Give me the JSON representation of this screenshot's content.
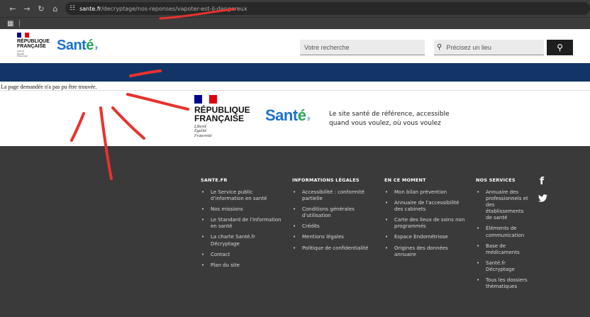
{
  "browser": {
    "url_host": "sante.fr",
    "url_path": "/decryptage/nos-reponses/vapoter-est-il-dangereux"
  },
  "header": {
    "rf_line1": "RÉPUBLIQUE",
    "rf_line2": "FRANÇAISE",
    "motto": [
      "Liberté",
      "Égalité",
      "Fraternité"
    ],
    "logo_main": "Sant",
    "logo_accent": "é",
    "logo_suffix": ".fr",
    "search_placeholder": "Votre recherche",
    "place_placeholder": "Précisez un lieu"
  },
  "error_message": "La page demandée n'a pas pu être trouvée.",
  "brand": {
    "tagline_line1": "Le site santé de référence, accessible",
    "tagline_line2": "quand vous voulez, où vous voulez"
  },
  "footer": {
    "columns": [
      {
        "title": "SANTE.FR",
        "items": [
          "Le Service public d'information en santé",
          "Nos missions",
          "Le Standard de l'information en santé",
          "La charte Santé.fr Décryptage",
          "Contact",
          "Plan du site"
        ]
      },
      {
        "title": "INFORMATIONS LÉGALES",
        "items": [
          "Accessibilité : conformité partielle",
          "Conditions générales d'utilisation",
          "Crédits",
          "Mentions légales",
          "Politique de confidentialité"
        ]
      },
      {
        "title": "EN CE MOMENT",
        "items": [
          "Mon bilan prévention",
          "Annuaire de l'accessibilité des cabinets",
          "Carte des lieux de soins non programmés",
          "Espace Endométriose",
          "Origines des données annuaire"
        ]
      },
      {
        "title": "NOS SERVICES",
        "items": [
          "Annuaire des professionnels et des établissements de santé",
          "Éléments de communication",
          "Base de médicaments",
          "Santé.fr Décryptage",
          "Tous les dossiers thématiques"
        ]
      }
    ]
  },
  "colors": {
    "nav_band": "#133466",
    "footer_bg": "#3a3a3a",
    "annotation": "#e8322e"
  }
}
